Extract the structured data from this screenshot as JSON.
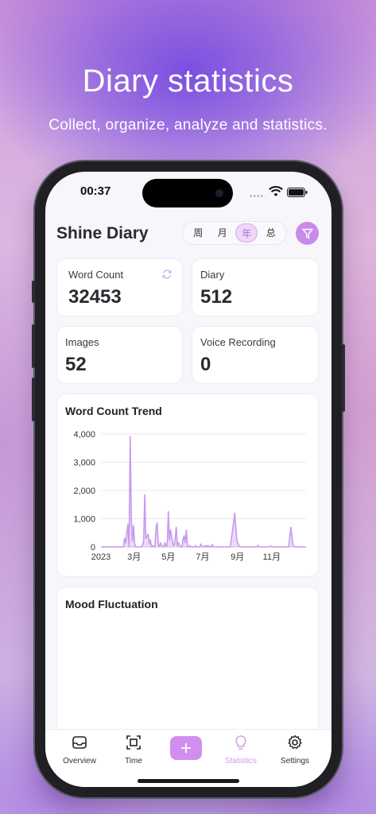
{
  "promo": {
    "headline": "Diary statistics",
    "subline": "Collect, organize, analyze and statistics."
  },
  "status_bar": {
    "time": "00:37"
  },
  "header": {
    "title": "Shine Diary",
    "periods": [
      "周",
      "月",
      "年",
      "总"
    ],
    "active_period": "年"
  },
  "stats": {
    "word_count": {
      "label": "Word Count",
      "value": "32453"
    },
    "diary": {
      "label": "Diary",
      "value": "512"
    },
    "images": {
      "label": "Images",
      "value": "52"
    },
    "voice": {
      "label": "Voice Recording",
      "value": "0"
    }
  },
  "trend": {
    "title": "Word Count Trend"
  },
  "mood": {
    "title": "Mood Fluctuation"
  },
  "tabs": [
    {
      "label": "Overview",
      "icon": "inbox-icon"
    },
    {
      "label": "Time",
      "icon": "scan-icon"
    },
    {
      "label": "",
      "icon": "plus-icon"
    },
    {
      "label": "Statistics",
      "icon": "lightbulb-icon"
    },
    {
      "label": "Settings",
      "icon": "gear-icon"
    }
  ],
  "colors": {
    "accent": "#c98bea",
    "chart_line": "#c89aee"
  },
  "chart_data": {
    "type": "area",
    "title": "Word Count Trend",
    "xlabel": "",
    "ylabel": "",
    "x_ticks": [
      "2023",
      "3月",
      "5月",
      "7月",
      "9月",
      "11月"
    ],
    "y_ticks": [
      "0",
      "1,000",
      "2,000",
      "3,000",
      "4,000"
    ],
    "ylim": [
      0,
      4000
    ],
    "xlim_days": [
      0,
      365
    ],
    "grid": true,
    "x_day": [
      0,
      40,
      42,
      44,
      46,
      48,
      50,
      52,
      54,
      56,
      58,
      60,
      62,
      64,
      66,
      68,
      70,
      72,
      74,
      76,
      78,
      80,
      84,
      86,
      88,
      90,
      92,
      94,
      96,
      98,
      100,
      102,
      104,
      106,
      108,
      110,
      112,
      114,
      116,
      118,
      120,
      122,
      124,
      126,
      128,
      130,
      132,
      134,
      136,
      138,
      140,
      142,
      144,
      146,
      148,
      150,
      152,
      154,
      156,
      158,
      160,
      162,
      164,
      166,
      168,
      170,
      172,
      174,
      176,
      178,
      180,
      182,
      184,
      186,
      188,
      190,
      192,
      194,
      196,
      198,
      200,
      202,
      204,
      206,
      210,
      214,
      218,
      222,
      226,
      230,
      234,
      238,
      242,
      246,
      250,
      254,
      258,
      262,
      266,
      270,
      274,
      276,
      278,
      280,
      282,
      284,
      286,
      290,
      294,
      298,
      302,
      306,
      310,
      314,
      318,
      322,
      326,
      330,
      334,
      338,
      342,
      346,
      350,
      354,
      358,
      365
    ],
    "values": [
      0,
      0,
      300,
      150,
      500,
      800,
      0,
      3920,
      1000,
      200,
      750,
      100,
      0,
      0,
      0,
      0,
      0,
      0,
      60,
      200,
      1850,
      300,
      450,
      100,
      250,
      0,
      50,
      0,
      0,
      700,
      850,
      100,
      0,
      150,
      50,
      0,
      50,
      150,
      0,
      100,
      1250,
      250,
      600,
      350,
      100,
      50,
      250,
      700,
      50,
      150,
      50,
      0,
      0,
      250,
      400,
      150,
      600,
      0,
      0,
      50,
      0,
      0,
      0,
      0,
      50,
      0,
      0,
      0,
      0,
      100,
      30,
      0,
      0,
      50,
      0,
      50,
      0,
      20,
      0,
      80,
      10,
      0,
      0,
      0,
      0,
      0,
      0,
      0,
      0,
      0,
      550,
      1200,
      200,
      20,
      0,
      0,
      0,
      0,
      0,
      0,
      0,
      0,
      0,
      50,
      0,
      0,
      0,
      0,
      0,
      0,
      30,
      0,
      0,
      0,
      0,
      0,
      0,
      0,
      0,
      700,
      50,
      0,
      0,
      0,
      0,
      0
    ]
  }
}
